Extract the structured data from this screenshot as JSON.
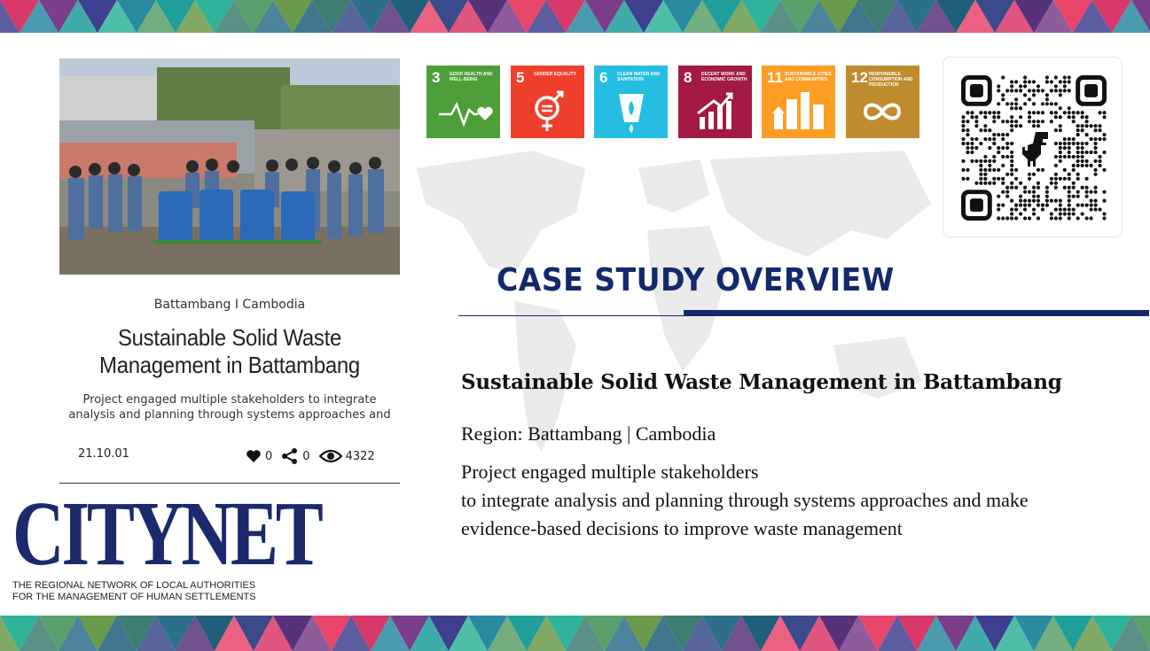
{
  "colors": {
    "navy": "#14296b",
    "logo_blue": "#1b2a6b",
    "sdg3": "#4c9f38",
    "sdg5": "#ef402b",
    "sdg6": "#26bde2",
    "sdg8": "#a21942",
    "sdg11": "#fd9d24",
    "sdg12": "#bf8b2e"
  },
  "card": {
    "location": "Battambang I Cambodia",
    "title_line1": "Sustainable Solid Waste",
    "title_line2": "Management in Battambang",
    "excerpt_line1": "Project engaged multiple stakeholders to integrate",
    "excerpt_line2": "analysis and planning through systems approaches and",
    "date": "21.10.01",
    "likes": "0",
    "shares": "0",
    "views": "4322",
    "icons": [
      "heart-icon",
      "share-icon",
      "eye-icon"
    ]
  },
  "logo": {
    "wordmark": "CITYNET",
    "tagline1": "THE REGIONAL NETWORK OF LOCAL AUTHORITIES",
    "tagline2": "FOR THE MANAGEMENT OF HUMAN SETTLEMENTS"
  },
  "sdgs": [
    {
      "number": "3",
      "label": "GOOD HEALTH AND WELL-BEING",
      "icon": "heartbeat-icon"
    },
    {
      "number": "5",
      "label": "GENDER EQUALITY",
      "icon": "gender-equality-icon"
    },
    {
      "number": "6",
      "label": "CLEAN WATER AND SANITATION",
      "icon": "water-drop-icon"
    },
    {
      "number": "8",
      "label": "DECENT WORK AND ECONOMIC GROWTH",
      "icon": "growth-chart-icon"
    },
    {
      "number": "11",
      "label": "SUSTAINABLE CITIES AND COMMUNITIES",
      "icon": "city-icon"
    },
    {
      "number": "12",
      "label": "RESPONSIBLE CONSUMPTION AND PRODUCTION",
      "icon": "infinity-loop-icon"
    }
  ],
  "heading": "CASE STUDY OVERVIEW",
  "overview": {
    "title": "Sustainable Solid Waste Management in Battambang",
    "region": "Region: Battambang | Cambodia",
    "desc_line1": "Project engaged multiple stakeholders",
    "desc_line2": "to integrate analysis and planning through systems approaches and make",
    "desc_line3": "evidence-based decisions to improve waste management"
  }
}
